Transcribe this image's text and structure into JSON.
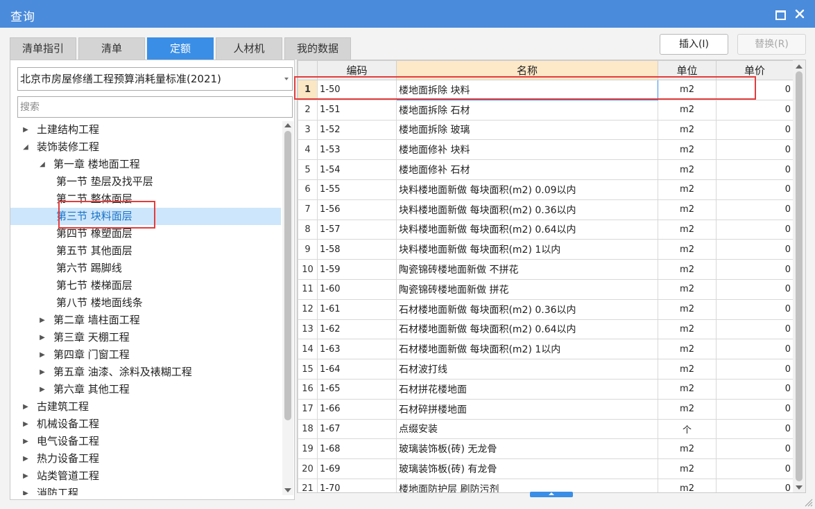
{
  "window": {
    "title": "查询"
  },
  "tabs": [
    {
      "label": "清单指引",
      "active": false
    },
    {
      "label": "清单",
      "active": false
    },
    {
      "label": "定额",
      "active": true
    },
    {
      "label": "人材机",
      "active": false
    },
    {
      "label": "我的数据",
      "active": false
    }
  ],
  "toolbar": {
    "insert_label": "插入(I)",
    "replace_label": "替换(R)"
  },
  "library": {
    "selected": "北京市房屋修缮工程预算消耗量标准(2021)"
  },
  "search": {
    "placeholder": "搜索",
    "value": ""
  },
  "tree": [
    {
      "label": "土建结构工程",
      "level": 0,
      "state": "collapsed"
    },
    {
      "label": "装饰装修工程",
      "level": 0,
      "state": "expanded"
    },
    {
      "label": "第一章 楼地面工程",
      "level": 1,
      "state": "expanded"
    },
    {
      "label": "第一节 垫层及找平层",
      "level": 2,
      "state": "leaf"
    },
    {
      "label": "第二节 整体面层",
      "level": 2,
      "state": "leaf"
    },
    {
      "label": "第三节 块料面层",
      "level": 2,
      "state": "leaf",
      "selected": true
    },
    {
      "label": "第四节 橡塑面层",
      "level": 2,
      "state": "leaf"
    },
    {
      "label": "第五节 其他面层",
      "level": 2,
      "state": "leaf"
    },
    {
      "label": "第六节 踢脚线",
      "level": 2,
      "state": "leaf"
    },
    {
      "label": "第七节 楼梯面层",
      "level": 2,
      "state": "leaf"
    },
    {
      "label": "第八节 楼地面线条",
      "level": 2,
      "state": "leaf"
    },
    {
      "label": "第二章 墙柱面工程",
      "level": 1,
      "state": "collapsed"
    },
    {
      "label": "第三章 天棚工程",
      "level": 1,
      "state": "collapsed"
    },
    {
      "label": "第四章 门窗工程",
      "level": 1,
      "state": "collapsed"
    },
    {
      "label": "第五章 油漆、涂料及裱糊工程",
      "level": 1,
      "state": "collapsed"
    },
    {
      "label": "第六章 其他工程",
      "level": 1,
      "state": "collapsed"
    },
    {
      "label": "古建筑工程",
      "level": 0,
      "state": "collapsed"
    },
    {
      "label": "机械设备工程",
      "level": 0,
      "state": "collapsed"
    },
    {
      "label": "电气设备工程",
      "level": 0,
      "state": "collapsed"
    },
    {
      "label": "热力设备工程",
      "level": 0,
      "state": "collapsed"
    },
    {
      "label": "站类管道工程",
      "level": 0,
      "state": "collapsed"
    },
    {
      "label": "消防工程",
      "level": 0,
      "state": "collapsed"
    }
  ],
  "grid": {
    "columns": {
      "code": "编码",
      "name": "名称",
      "unit": "单位",
      "price": "单价"
    },
    "current_row": 0,
    "rows": [
      {
        "no": "1",
        "code": "1-50",
        "name": "楼地面拆除 块料",
        "unit": "m2",
        "price": "0"
      },
      {
        "no": "2",
        "code": "1-51",
        "name": "楼地面拆除 石材",
        "unit": "m2",
        "price": "0"
      },
      {
        "no": "3",
        "code": "1-52",
        "name": "楼地面拆除 玻璃",
        "unit": "m2",
        "price": "0"
      },
      {
        "no": "4",
        "code": "1-53",
        "name": "楼地面修补 块料",
        "unit": "m2",
        "price": "0"
      },
      {
        "no": "5",
        "code": "1-54",
        "name": "楼地面修补 石材",
        "unit": "m2",
        "price": "0"
      },
      {
        "no": "6",
        "code": "1-55",
        "name": "块料楼地面新做 每块面积(m2) 0.09以内",
        "unit": "m2",
        "price": "0"
      },
      {
        "no": "7",
        "code": "1-56",
        "name": "块料楼地面新做 每块面积(m2) 0.36以内",
        "unit": "m2",
        "price": "0"
      },
      {
        "no": "8",
        "code": "1-57",
        "name": "块料楼地面新做 每块面积(m2) 0.64以内",
        "unit": "m2",
        "price": "0"
      },
      {
        "no": "9",
        "code": "1-58",
        "name": "块料楼地面新做 每块面积(m2) 1以内",
        "unit": "m2",
        "price": "0"
      },
      {
        "no": "10",
        "code": "1-59",
        "name": "陶瓷锦砖楼地面新做 不拼花",
        "unit": "m2",
        "price": "0"
      },
      {
        "no": "11",
        "code": "1-60",
        "name": "陶瓷锦砖楼地面新做 拼花",
        "unit": "m2",
        "price": "0"
      },
      {
        "no": "12",
        "code": "1-61",
        "name": "石材楼地面新做 每块面积(m2) 0.36以内",
        "unit": "m2",
        "price": "0"
      },
      {
        "no": "13",
        "code": "1-62",
        "name": "石材楼地面新做 每块面积(m2) 0.64以内",
        "unit": "m2",
        "price": "0"
      },
      {
        "no": "14",
        "code": "1-63",
        "name": "石材楼地面新做 每块面积(m2) 1以内",
        "unit": "m2",
        "price": "0"
      },
      {
        "no": "15",
        "code": "1-64",
        "name": "石材波打线",
        "unit": "m2",
        "price": "0"
      },
      {
        "no": "16",
        "code": "1-65",
        "name": "石材拼花楼地面",
        "unit": "m2",
        "price": "0"
      },
      {
        "no": "17",
        "code": "1-66",
        "name": "石材碎拼楼地面",
        "unit": "m2",
        "price": "0"
      },
      {
        "no": "18",
        "code": "1-67",
        "name": "点缀安装",
        "unit": "个",
        "price": "0"
      },
      {
        "no": "19",
        "code": "1-68",
        "name": "玻璃装饰板(砖) 无龙骨",
        "unit": "m2",
        "price": "0"
      },
      {
        "no": "20",
        "code": "1-69",
        "name": "玻璃装饰板(砖) 有龙骨",
        "unit": "m2",
        "price": "0"
      },
      {
        "no": "21",
        "code": "1-70",
        "name": "楼地面防护层 刷防污剂",
        "unit": "m2",
        "price": "0"
      }
    ]
  },
  "colors": {
    "title_bar": "#4a8bdb",
    "tab_active": "#3a8ee6",
    "highlight_box": "#e33c3c",
    "tree_selected_bg": "#cde6fb",
    "row_current_bg": "#fbe7c4"
  }
}
